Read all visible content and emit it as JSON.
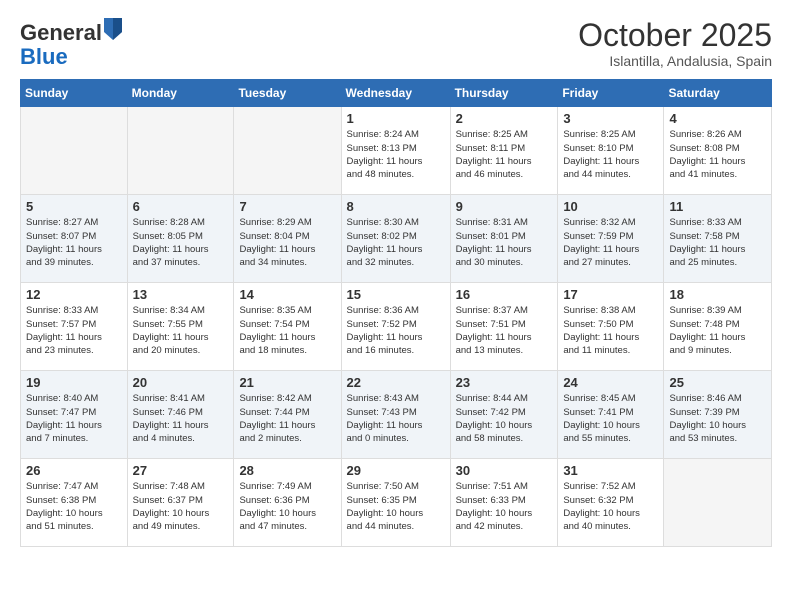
{
  "logo": {
    "general": "General",
    "blue": "Blue"
  },
  "title": "October 2025",
  "subtitle": "Islantilla, Andalusia, Spain",
  "days_of_week": [
    "Sunday",
    "Monday",
    "Tuesday",
    "Wednesday",
    "Thursday",
    "Friday",
    "Saturday"
  ],
  "weeks": [
    [
      {
        "day": "",
        "info": ""
      },
      {
        "day": "",
        "info": ""
      },
      {
        "day": "",
        "info": ""
      },
      {
        "day": "1",
        "info": "Sunrise: 8:24 AM\nSunset: 8:13 PM\nDaylight: 11 hours\nand 48 minutes."
      },
      {
        "day": "2",
        "info": "Sunrise: 8:25 AM\nSunset: 8:11 PM\nDaylight: 11 hours\nand 46 minutes."
      },
      {
        "day": "3",
        "info": "Sunrise: 8:25 AM\nSunset: 8:10 PM\nDaylight: 11 hours\nand 44 minutes."
      },
      {
        "day": "4",
        "info": "Sunrise: 8:26 AM\nSunset: 8:08 PM\nDaylight: 11 hours\nand 41 minutes."
      }
    ],
    [
      {
        "day": "5",
        "info": "Sunrise: 8:27 AM\nSunset: 8:07 PM\nDaylight: 11 hours\nand 39 minutes."
      },
      {
        "day": "6",
        "info": "Sunrise: 8:28 AM\nSunset: 8:05 PM\nDaylight: 11 hours\nand 37 minutes."
      },
      {
        "day": "7",
        "info": "Sunrise: 8:29 AM\nSunset: 8:04 PM\nDaylight: 11 hours\nand 34 minutes."
      },
      {
        "day": "8",
        "info": "Sunrise: 8:30 AM\nSunset: 8:02 PM\nDaylight: 11 hours\nand 32 minutes."
      },
      {
        "day": "9",
        "info": "Sunrise: 8:31 AM\nSunset: 8:01 PM\nDaylight: 11 hours\nand 30 minutes."
      },
      {
        "day": "10",
        "info": "Sunrise: 8:32 AM\nSunset: 7:59 PM\nDaylight: 11 hours\nand 27 minutes."
      },
      {
        "day": "11",
        "info": "Sunrise: 8:33 AM\nSunset: 7:58 PM\nDaylight: 11 hours\nand 25 minutes."
      }
    ],
    [
      {
        "day": "12",
        "info": "Sunrise: 8:33 AM\nSunset: 7:57 PM\nDaylight: 11 hours\nand 23 minutes."
      },
      {
        "day": "13",
        "info": "Sunrise: 8:34 AM\nSunset: 7:55 PM\nDaylight: 11 hours\nand 20 minutes."
      },
      {
        "day": "14",
        "info": "Sunrise: 8:35 AM\nSunset: 7:54 PM\nDaylight: 11 hours\nand 18 minutes."
      },
      {
        "day": "15",
        "info": "Sunrise: 8:36 AM\nSunset: 7:52 PM\nDaylight: 11 hours\nand 16 minutes."
      },
      {
        "day": "16",
        "info": "Sunrise: 8:37 AM\nSunset: 7:51 PM\nDaylight: 11 hours\nand 13 minutes."
      },
      {
        "day": "17",
        "info": "Sunrise: 8:38 AM\nSunset: 7:50 PM\nDaylight: 11 hours\nand 11 minutes."
      },
      {
        "day": "18",
        "info": "Sunrise: 8:39 AM\nSunset: 7:48 PM\nDaylight: 11 hours\nand 9 minutes."
      }
    ],
    [
      {
        "day": "19",
        "info": "Sunrise: 8:40 AM\nSunset: 7:47 PM\nDaylight: 11 hours\nand 7 minutes."
      },
      {
        "day": "20",
        "info": "Sunrise: 8:41 AM\nSunset: 7:46 PM\nDaylight: 11 hours\nand 4 minutes."
      },
      {
        "day": "21",
        "info": "Sunrise: 8:42 AM\nSunset: 7:44 PM\nDaylight: 11 hours\nand 2 minutes."
      },
      {
        "day": "22",
        "info": "Sunrise: 8:43 AM\nSunset: 7:43 PM\nDaylight: 11 hours\nand 0 minutes."
      },
      {
        "day": "23",
        "info": "Sunrise: 8:44 AM\nSunset: 7:42 PM\nDaylight: 10 hours\nand 58 minutes."
      },
      {
        "day": "24",
        "info": "Sunrise: 8:45 AM\nSunset: 7:41 PM\nDaylight: 10 hours\nand 55 minutes."
      },
      {
        "day": "25",
        "info": "Sunrise: 8:46 AM\nSunset: 7:39 PM\nDaylight: 10 hours\nand 53 minutes."
      }
    ],
    [
      {
        "day": "26",
        "info": "Sunrise: 7:47 AM\nSunset: 6:38 PM\nDaylight: 10 hours\nand 51 minutes."
      },
      {
        "day": "27",
        "info": "Sunrise: 7:48 AM\nSunset: 6:37 PM\nDaylight: 10 hours\nand 49 minutes."
      },
      {
        "day": "28",
        "info": "Sunrise: 7:49 AM\nSunset: 6:36 PM\nDaylight: 10 hours\nand 47 minutes."
      },
      {
        "day": "29",
        "info": "Sunrise: 7:50 AM\nSunset: 6:35 PM\nDaylight: 10 hours\nand 44 minutes."
      },
      {
        "day": "30",
        "info": "Sunrise: 7:51 AM\nSunset: 6:33 PM\nDaylight: 10 hours\nand 42 minutes."
      },
      {
        "day": "31",
        "info": "Sunrise: 7:52 AM\nSunset: 6:32 PM\nDaylight: 10 hours\nand 40 minutes."
      },
      {
        "day": "",
        "info": ""
      }
    ]
  ]
}
